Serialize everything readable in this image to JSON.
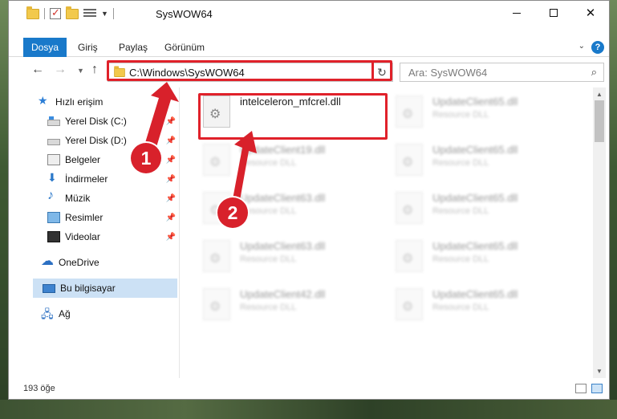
{
  "window": {
    "title": "SysWOW64"
  },
  "ribbon": {
    "tabs": [
      "Dosya",
      "Giriş",
      "Paylaş",
      "Görünüm"
    ]
  },
  "address": {
    "path": "C:\\Windows\\SysWOW64",
    "search_placeholder": "Ara: SysWOW64"
  },
  "sidebar": {
    "quick_access": "Hızlı erişim",
    "items": [
      {
        "label": "Yerel Disk (C:)",
        "icon": "drive-c-icon"
      },
      {
        "label": "Yerel Disk (D:)",
        "icon": "drive-d-icon"
      },
      {
        "label": "Belgeler",
        "icon": "documents-icon"
      },
      {
        "label": "İndirmeler",
        "icon": "downloads-icon"
      },
      {
        "label": "Müzik",
        "icon": "music-icon"
      },
      {
        "label": "Resimler",
        "icon": "pictures-icon"
      },
      {
        "label": "Videolar",
        "icon": "videos-icon"
      }
    ],
    "onedrive": "OneDrive",
    "this_pc": "Bu bilgisayar",
    "network": "Ağ"
  },
  "files": [
    {
      "name": "intelceleron_mfcrel.dll",
      "type": ""
    },
    {
      "name": "UpdateClient65.dll",
      "type": "Resource DLL"
    },
    {
      "name": "UpdateClient19.dll",
      "type": "Resource DLL"
    },
    {
      "name": "UpdateClient65.dll",
      "type": "Resource DLL"
    },
    {
      "name": "UpdateClient63.dll",
      "type": "Resource DLL"
    },
    {
      "name": "UpdateClient65.dll",
      "type": "Resource DLL"
    },
    {
      "name": "UpdateClient63.dll",
      "type": "Resource DLL"
    },
    {
      "name": "UpdateClient65.dll",
      "type": "Resource DLL"
    },
    {
      "name": "UpdateClient42.dll",
      "type": "Resource DLL"
    },
    {
      "name": "UpdateClient65.dll",
      "type": "Resource DLL"
    }
  ],
  "status": {
    "count": "193 öğe"
  },
  "annotations": {
    "step1": "1",
    "step2": "2",
    "color": "#d8212b"
  },
  "colors": {
    "accent": "#1979ca",
    "selection": "#cce1f5"
  }
}
